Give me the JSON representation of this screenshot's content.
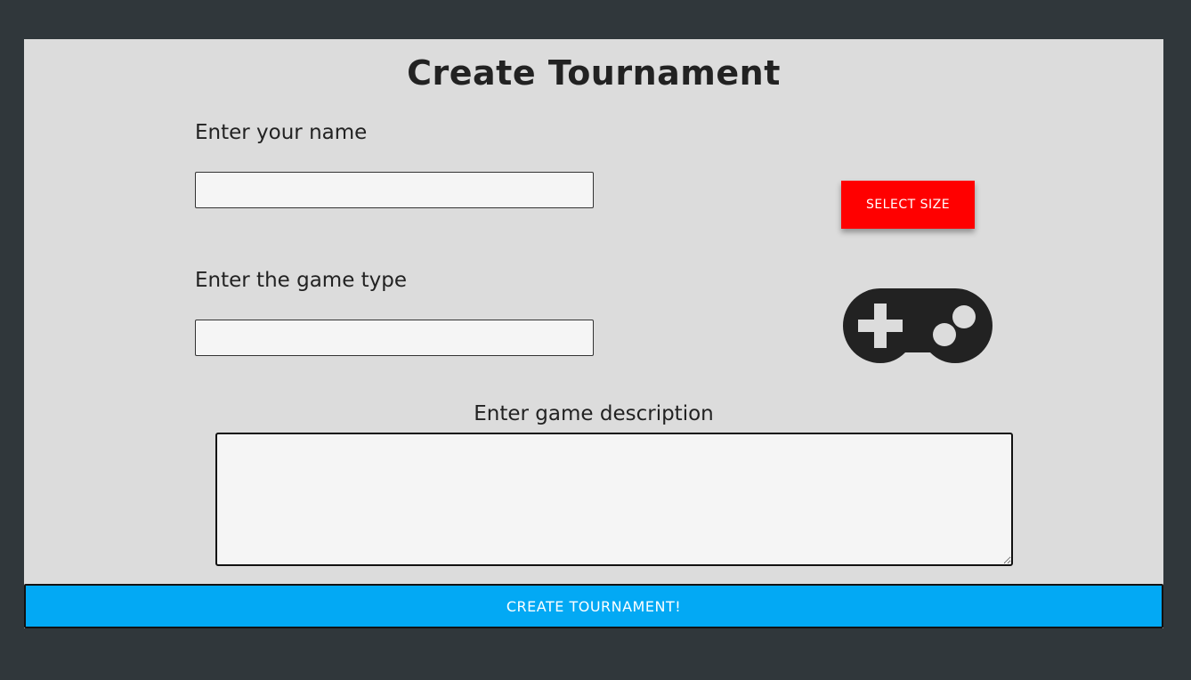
{
  "page": {
    "title": "Create Tournament"
  },
  "form": {
    "name_label": "Enter your name",
    "name_value": "",
    "game_type_label": "Enter the game type",
    "game_type_value": "",
    "description_label": "Enter game description",
    "description_value": "",
    "select_size_label": "SELECT SIZE",
    "submit_label": "CREATE TOURNAMENT!"
  },
  "icons": {
    "gamepad": "gamepad-icon"
  },
  "colors": {
    "background": "#30373b",
    "panel": "#dcdcdc",
    "select_size_button": "#ff0000",
    "submit_button": "#03a9f4",
    "icon": "#222222"
  }
}
